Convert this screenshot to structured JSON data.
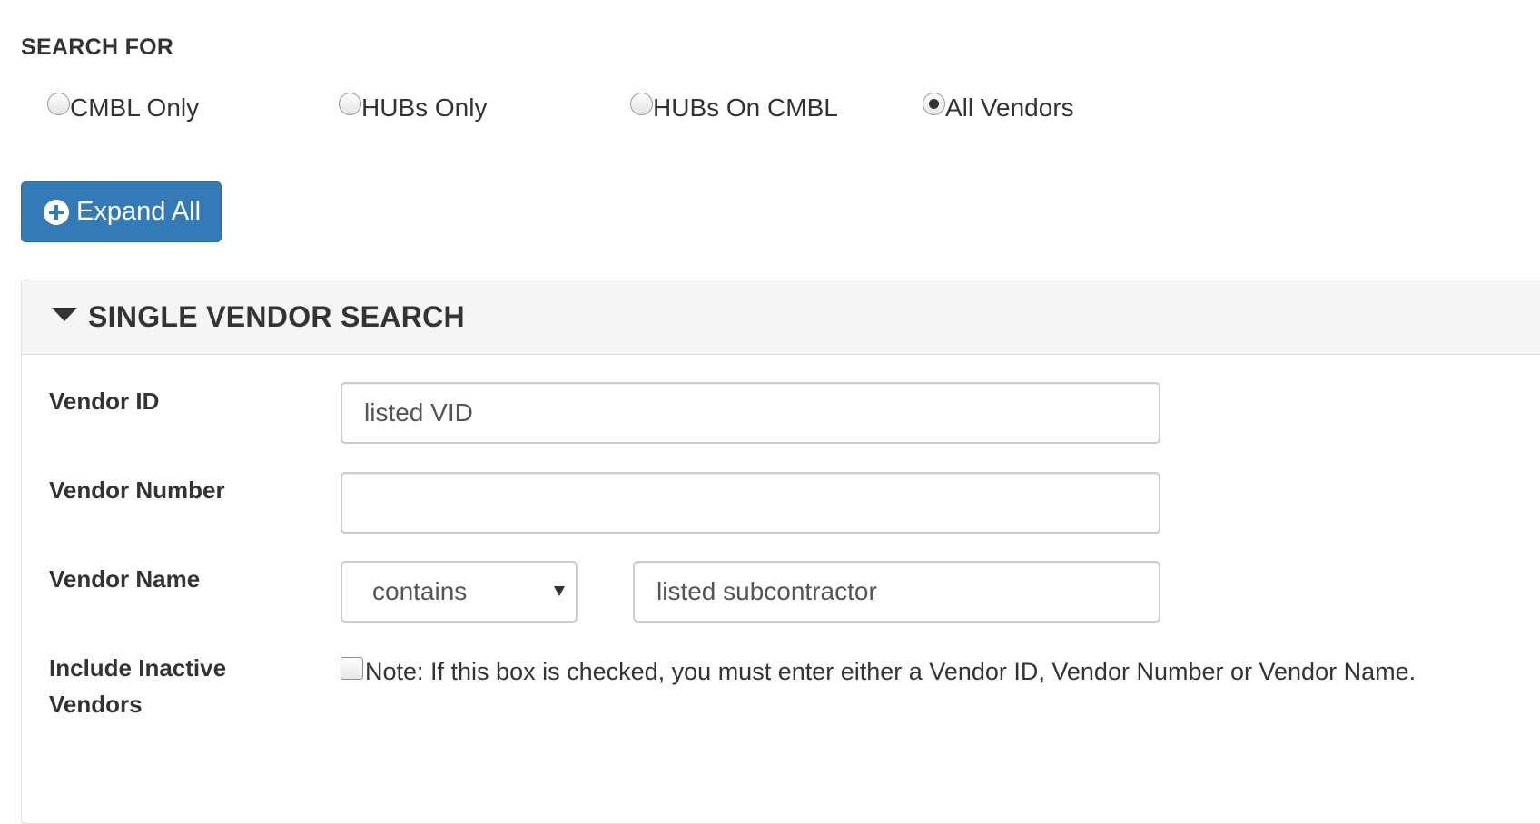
{
  "search_for": {
    "title": "SEARCH FOR",
    "options": [
      {
        "label": "CMBL Only",
        "checked": false
      },
      {
        "label": "HUBs Only",
        "checked": false
      },
      {
        "label": "HUBs On CMBL",
        "checked": false
      },
      {
        "label": "All Vendors",
        "checked": true
      }
    ]
  },
  "expand_button": {
    "label": "Expand All",
    "icon": "plus-circle-icon",
    "color": "#337ab7"
  },
  "single_vendor_panel": {
    "title": "SINGLE VENDOR SEARCH",
    "expanded": true,
    "vendor_id": {
      "label": "Vendor ID",
      "value": "listed VID"
    },
    "vendor_number": {
      "label": "Vendor Number",
      "value": ""
    },
    "vendor_name": {
      "label": "Vendor Name",
      "operator": "contains",
      "value": "listed subcontractor"
    },
    "include_inactive": {
      "label_line1": "Include Inactive",
      "label_line2": "Vendors",
      "checked": false,
      "note": "Note: If this box is checked, you must enter either a Vendor ID, Vendor Number or Vendor Name."
    }
  }
}
